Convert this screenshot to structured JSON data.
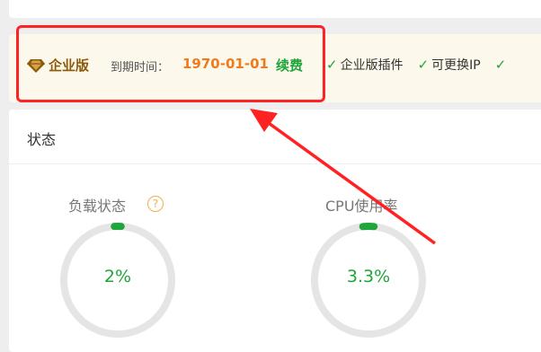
{
  "license": {
    "edition": "企业版",
    "expire_label": "到期时间：",
    "expire_date": "1970-01-01",
    "renew": "续费",
    "features": [
      "企业版插件",
      "可更换IP"
    ]
  },
  "status": {
    "title": "状态",
    "load": {
      "label": "负载状态",
      "value": "2%",
      "percent": 2
    },
    "cpu": {
      "label": "CPU使用率",
      "value": "3.3%",
      "percent": 3.3
    }
  },
  "colors": {
    "accent_green": "#20a53a",
    "date_orange": "#f07b1d",
    "annotation_red": "#ff2222",
    "gauge_track": "#e5e5e5"
  },
  "icons": [
    "top-card",
    "diamond-icon",
    "check-icon",
    "help-icon"
  ]
}
